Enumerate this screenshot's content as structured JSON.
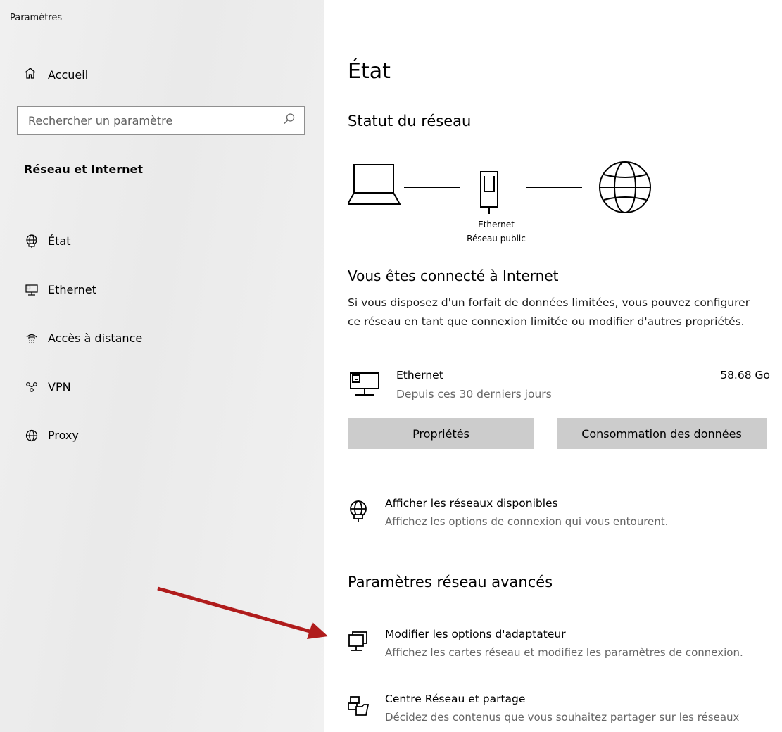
{
  "window": {
    "title": "Paramètres"
  },
  "sidebar": {
    "home_label": "Accueil",
    "search_placeholder": "Rechercher un paramètre",
    "section_title": "Réseau et Internet",
    "items": [
      {
        "label": "État",
        "icon": "globe-status-icon"
      },
      {
        "label": "Ethernet",
        "icon": "ethernet-icon"
      },
      {
        "label": "Accès à distance",
        "icon": "dialup-icon"
      },
      {
        "label": "VPN",
        "icon": "vpn-icon"
      },
      {
        "label": "Proxy",
        "icon": "globe-icon"
      }
    ]
  },
  "main": {
    "title": "État",
    "network_status_heading": "Statut du réseau",
    "diagram": {
      "adapter_name": "Ethernet",
      "network_type": "Réseau public"
    },
    "connected_title": "Vous êtes connecté à Internet",
    "connected_desc": "Si vous disposez d'un forfait de données limitées, vous pouvez configurer ce réseau en tant que connexion limitée ou modifier d'autres propriétés.",
    "usage": {
      "name": "Ethernet",
      "period": "Depuis ces 30 derniers jours",
      "amount": "58.68 Go"
    },
    "buttons": {
      "properties": "Propriétés",
      "data_usage": "Consommation des données"
    },
    "available_networks": {
      "title": "Afficher les réseaux disponibles",
      "desc": "Affichez les options de connexion qui vous entourent."
    },
    "advanced_heading": "Paramètres réseau avancés",
    "adapter_options": {
      "title": "Modifier les options d'adaptateur",
      "desc": "Affichez les cartes réseau et modifiez les paramètres de connexion."
    },
    "sharing_center": {
      "title": "Centre Réseau et partage",
      "desc": "Décidez des contenus que vous souhaitez partager sur les réseaux"
    }
  },
  "colors": {
    "annotation_arrow": "#b01c1c",
    "button_bg": "#cccccc",
    "secondary_text": "#666666"
  }
}
